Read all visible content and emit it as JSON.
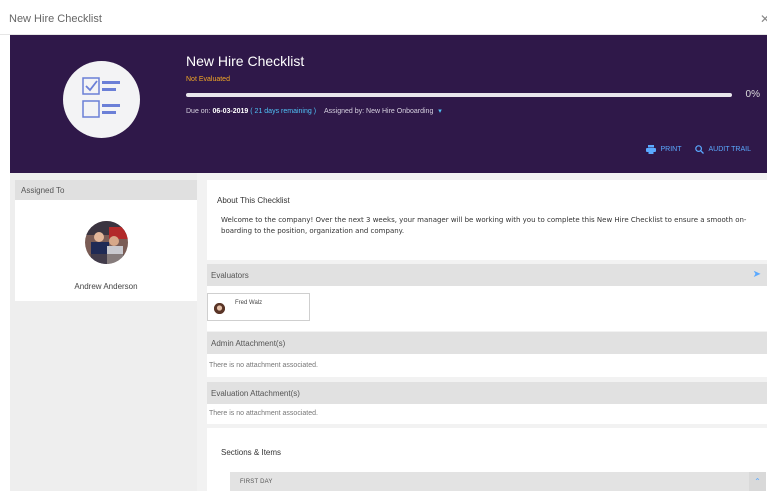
{
  "window": {
    "title": "New Hire Checklist",
    "close_glyph": "✕"
  },
  "hero": {
    "title": "New Hire Checklist",
    "status": "Not Evaluated",
    "progress_percent": 0,
    "progress_label": "0%",
    "due_prefix": "Due on:",
    "due_date": "06-03-2019",
    "remaining_open": "(",
    "remaining": "21 days remaining",
    "remaining_close": ")",
    "assigned_by": "Assigned by: New Hire Onboarding",
    "print_label": "PRINT",
    "audit_label": "AUDIT TRAIL",
    "icon": "checklist-icon"
  },
  "assigned": {
    "header": "Assigned To",
    "name": "Andrew Anderson"
  },
  "about": {
    "title": "About This Checklist",
    "body": "Welcome to the company! Over the next 3 weeks, your manager will be working with you to complete this New Hire Checklist to ensure a smooth on-boarding to the position, organization and company."
  },
  "evaluators": {
    "header": "Evaluators",
    "items": [
      {
        "name": "Fred Walz"
      }
    ]
  },
  "admin_attachments": {
    "header": "Admin Attachment(s)",
    "empty": "There is no attachment associated."
  },
  "evaluation_attachments": {
    "header": "Evaluation Attachment(s)",
    "empty": "There is no attachment associated."
  },
  "sections": {
    "title": "Sections & Items",
    "items": [
      {
        "label": "FIRST DAY"
      }
    ]
  },
  "colors": {
    "hero_bg": "#2f1849",
    "accent": "#5aa9ff",
    "status": "#f2a825"
  }
}
